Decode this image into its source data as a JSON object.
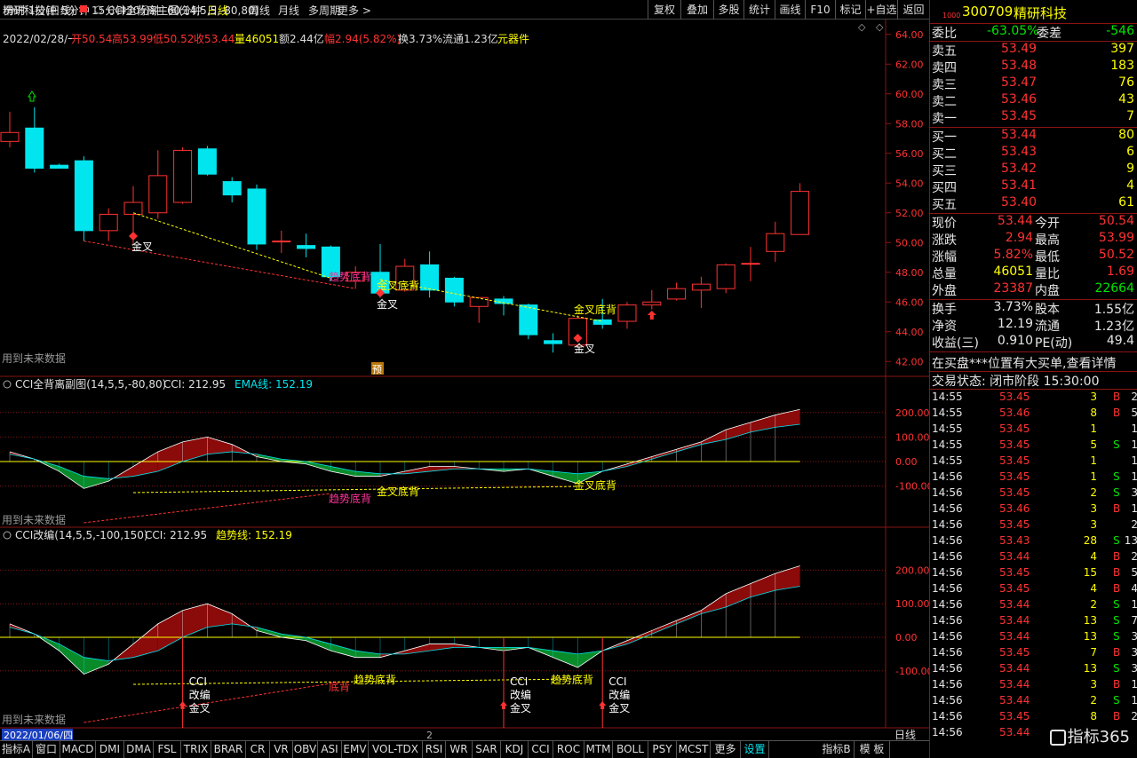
{
  "toolbar": {
    "timeframes": [
      "分时",
      "1分钟",
      "5分钟",
      "15分钟",
      "30分钟",
      "60分钟",
      "日线",
      "周线",
      "月线",
      "多周期",
      "更多 >"
    ],
    "right_buttons": [
      "复权",
      "叠加",
      "多股",
      "统计",
      "画线",
      "F10",
      "标记",
      "+自选",
      "返回"
    ]
  },
  "main": {
    "title": "精研科技(日线)",
    "indicator": "CCI全背离主图(14,5,5,-80,80)",
    "ohlc_line": {
      "date": "2022/02/28/一",
      "open": "开50.54",
      "high": "高53.99",
      "low": "低50.52",
      "close": "收53.44",
      "volume": "量46051",
      "amount": "额2.44亿",
      "change": "幅2.94(5.82%)",
      "turnover": "换3.73%",
      "float": "流通1.23亿",
      "sector": "元器件"
    },
    "price_ticks": [
      "64.00",
      "62.00",
      "60.00",
      "58.00",
      "56.00",
      "54.00",
      "52.00",
      "50.00",
      "48.00",
      "46.00",
      "44.00",
      "42.00"
    ],
    "future_note": "用到未来数据",
    "pred_badge": "预",
    "labels": [
      "金叉",
      "趋势底背",
      "金叉底背",
      "金叉",
      "金叉底背",
      "金叉"
    ]
  },
  "sub1": {
    "title": "CCI全背离副图(14,5,5,-80,80)",
    "cci_label": "CCI: 212.95",
    "ema_label": "EMA线: 152.19",
    "ticks": [
      "200.00",
      "100.00",
      "0.00",
      "-100.00"
    ],
    "labels": [
      "趋势底背",
      "金叉底背",
      "金叉底背"
    ],
    "future_note": "用到未来数据"
  },
  "sub2": {
    "title": "CCI改编(14,5,5,-100,150)",
    "cci_label": "CCI: 212.95",
    "trend_label": "趋势线: 152.19",
    "ticks": [
      "200.00",
      "100.00",
      "0.00",
      "-100.00"
    ],
    "signal_lines": [
      "CCI",
      "改编",
      "金叉"
    ],
    "labels": [
      "底背",
      "趋势底背",
      "趋势底背"
    ],
    "future_note": "用到未来数据"
  },
  "date_footer": "2022/01/06/四",
  "page_marker": "2",
  "period_label": "日线",
  "bottom_tabs": [
    "指标A",
    "窗口",
    "MACD",
    "DMI",
    "DMA",
    "FSL",
    "TRIX",
    "BRAR",
    "CR",
    "VR",
    "OBV",
    "ASI",
    "EMV",
    "VOL-TDX",
    "RSI",
    "WR",
    "SAR",
    "KDJ",
    "CCI",
    "ROC",
    "MTM",
    "BOLL",
    "PSY",
    "MCST",
    "更多",
    "设置"
  ],
  "bottom_right": [
    "指标B",
    "模 板"
  ],
  "quote": {
    "code": "300709",
    "name": "精研科技",
    "mini": "1000",
    "weibi_label": "委比",
    "weibi": "-63.05%",
    "weicha_label": "委差",
    "weicha": "-546",
    "asks": [
      {
        "label": "卖五",
        "price": "53.49",
        "vol": "397"
      },
      {
        "label": "卖四",
        "price": "53.48",
        "vol": "183"
      },
      {
        "label": "卖三",
        "price": "53.47",
        "vol": "76"
      },
      {
        "label": "卖二",
        "price": "53.46",
        "vol": "43"
      },
      {
        "label": "卖一",
        "price": "53.45",
        "vol": "7"
      }
    ],
    "bids": [
      {
        "label": "买一",
        "price": "53.44",
        "vol": "80"
      },
      {
        "label": "买二",
        "price": "53.43",
        "vol": "6"
      },
      {
        "label": "买三",
        "price": "53.42",
        "vol": "9"
      },
      {
        "label": "买四",
        "price": "53.41",
        "vol": "4"
      },
      {
        "label": "买五",
        "price": "53.40",
        "vol": "61"
      }
    ],
    "stats": [
      {
        "l1": "现价",
        "v1": "53.44",
        "c1": "red",
        "l2": "今开",
        "v2": "50.54",
        "c2": "red"
      },
      {
        "l1": "涨跌",
        "v1": "2.94",
        "c1": "red",
        "l2": "最高",
        "v2": "53.99",
        "c2": "red"
      },
      {
        "l1": "涨幅",
        "v1": "5.82%",
        "c1": "red",
        "l2": "最低",
        "v2": "50.52",
        "c2": "red"
      },
      {
        "l1": "总量",
        "v1": "46051",
        "c1": "yellow",
        "l2": "量比",
        "v2": "1.69",
        "c2": "red"
      },
      {
        "l1": "外盘",
        "v1": "23387",
        "c1": "red",
        "l2": "内盘",
        "v2": "22664",
        "c2": "green"
      }
    ],
    "stats2": [
      {
        "l1": "换手",
        "v1": "3.73%",
        "l2": "股本",
        "v2": "1.55亿"
      },
      {
        "l1": "净资",
        "v1": "12.19",
        "l2": "流通",
        "v2": "1.23亿"
      },
      {
        "l1": "收益(三)",
        "v1": "0.910",
        "l2": "PE(动)",
        "v2": "49.4"
      }
    ],
    "notice": "在买盘***位置有大买单,查看详情",
    "status": "交易状态: 闭市阶段 15:30:00",
    "ticks": [
      {
        "t": "14:55",
        "p": "53.45",
        "v": "3",
        "d": "B",
        "n": "2"
      },
      {
        "t": "14:55",
        "p": "53.46",
        "v": "8",
        "d": "B",
        "n": "5"
      },
      {
        "t": "14:55",
        "p": "53.45",
        "v": "1",
        "d": "",
        "n": "1"
      },
      {
        "t": "14:55",
        "p": "53.45",
        "v": "5",
        "d": "S",
        "n": "1"
      },
      {
        "t": "14:55",
        "p": "53.45",
        "v": "1",
        "d": "",
        "n": "1"
      },
      {
        "t": "14:56",
        "p": "53.45",
        "v": "1",
        "d": "S",
        "n": "1"
      },
      {
        "t": "14:56",
        "p": "53.45",
        "v": "2",
        "d": "S",
        "n": "3"
      },
      {
        "t": "14:56",
        "p": "53.46",
        "v": "3",
        "d": "B",
        "n": "1"
      },
      {
        "t": "14:56",
        "p": "53.45",
        "v": "3",
        "d": "",
        "n": "2"
      },
      {
        "t": "14:56",
        "p": "53.43",
        "v": "28",
        "d": "S",
        "n": "13"
      },
      {
        "t": "14:56",
        "p": "53.44",
        "v": "4",
        "d": "B",
        "n": "2"
      },
      {
        "t": "14:56",
        "p": "53.45",
        "v": "15",
        "d": "B",
        "n": "5"
      },
      {
        "t": "14:56",
        "p": "53.45",
        "v": "4",
        "d": "B",
        "n": "4"
      },
      {
        "t": "14:56",
        "p": "53.44",
        "v": "2",
        "d": "S",
        "n": "1"
      },
      {
        "t": "14:56",
        "p": "53.44",
        "v": "13",
        "d": "S",
        "n": "7"
      },
      {
        "t": "14:56",
        "p": "53.44",
        "v": "13",
        "d": "S",
        "n": "3"
      },
      {
        "t": "14:56",
        "p": "53.45",
        "v": "7",
        "d": "B",
        "n": "3"
      },
      {
        "t": "14:56",
        "p": "53.44",
        "v": "13",
        "d": "S",
        "n": "3"
      },
      {
        "t": "14:56",
        "p": "53.44",
        "v": "3",
        "d": "B",
        "n": "1"
      },
      {
        "t": "14:56",
        "p": "53.44",
        "v": "2",
        "d": "S",
        "n": "1"
      },
      {
        "t": "14:56",
        "p": "53.45",
        "v": "8",
        "d": "B",
        "n": "2"
      },
      {
        "t": "14:56",
        "p": "53.44",
        "v": "",
        "d": "",
        "n": ""
      }
    ],
    "watermark": "指标365"
  },
  "colors": {
    "up": "#ff3232",
    "down": "#00e5ee",
    "grid": "#8a1414",
    "yellow": "#ffff00"
  },
  "chart_data": {
    "type": "candlestick",
    "price_range": [
      41,
      65
    ],
    "candles": [
      {
        "o": 56.8,
        "c": 57.4,
        "h": 58.8,
        "l": 56.4
      },
      {
        "o": 57.7,
        "c": 55.0,
        "h": 59.1,
        "l": 54.7
      },
      {
        "o": 55.2,
        "c": 55.0,
        "h": 55.3,
        "l": 55.0
      },
      {
        "o": 55.5,
        "c": 50.8,
        "h": 55.8,
        "l": 50.1
      },
      {
        "o": 50.8,
        "c": 51.9,
        "h": 52.3,
        "l": 50.1
      },
      {
        "o": 51.9,
        "c": 52.7,
        "h": 53.8,
        "l": 49.9
      },
      {
        "o": 52.0,
        "c": 54.5,
        "h": 56.2,
        "l": 51.6
      },
      {
        "o": 52.7,
        "c": 56.2,
        "h": 56.4,
        "l": 52.6
      },
      {
        "o": 56.3,
        "c": 54.6,
        "h": 56.5,
        "l": 54.5
      },
      {
        "o": 54.1,
        "c": 53.2,
        "h": 54.4,
        "l": 52.7
      },
      {
        "o": 53.6,
        "c": 49.9,
        "h": 53.9,
        "l": 49.5
      },
      {
        "o": 50.1,
        "c": 50.1,
        "h": 50.8,
        "l": 49.3
      },
      {
        "o": 49.8,
        "c": 49.6,
        "h": 50.6,
        "l": 49.0
      },
      {
        "o": 49.7,
        "c": 47.7,
        "h": 49.8,
        "l": 47.4
      },
      {
        "o": 47.4,
        "c": 48.0,
        "h": 48.4,
        "l": 46.9
      },
      {
        "o": 48.0,
        "c": 46.6,
        "h": 49.9,
        "l": 46.3
      },
      {
        "o": 46.8,
        "c": 48.4,
        "h": 48.9,
        "l": 46.7
      },
      {
        "o": 48.5,
        "c": 46.8,
        "h": 49.4,
        "l": 46.3
      },
      {
        "o": 47.6,
        "c": 46.0,
        "h": 47.7,
        "l": 45.7
      },
      {
        "o": 45.7,
        "c": 46.3,
        "h": 46.3,
        "l": 44.6
      },
      {
        "o": 46.2,
        "c": 45.9,
        "h": 46.4,
        "l": 45.1
      },
      {
        "o": 45.8,
        "c": 43.8,
        "h": 45.9,
        "l": 43.5
      },
      {
        "o": 43.4,
        "c": 43.2,
        "h": 43.9,
        "l": 42.6
      },
      {
        "o": 43.1,
        "c": 44.9,
        "h": 45.1,
        "l": 42.9
      },
      {
        "o": 44.8,
        "c": 44.5,
        "h": 46.2,
        "l": 44.2
      },
      {
        "o": 44.7,
        "c": 45.8,
        "h": 46.0,
        "l": 44.2
      },
      {
        "o": 45.8,
        "c": 46.0,
        "h": 46.8,
        "l": 45.5
      },
      {
        "o": 46.2,
        "c": 46.9,
        "h": 47.3,
        "l": 46.1
      },
      {
        "o": 46.8,
        "c": 47.2,
        "h": 47.7,
        "l": 45.6
      },
      {
        "o": 46.9,
        "c": 48.5,
        "h": 48.6,
        "l": 46.6
      },
      {
        "o": 48.6,
        "c": 48.6,
        "h": 49.7,
        "l": 47.4
      },
      {
        "o": 49.4,
        "c": 50.6,
        "h": 51.4,
        "l": 48.7
      },
      {
        "o": 50.54,
        "c": 53.44,
        "h": 53.99,
        "l": 50.52
      }
    ],
    "cci_sub1": {
      "cci": [
        40,
        10,
        -40,
        -110,
        -80,
        -20,
        40,
        80,
        100,
        70,
        20,
        0,
        -10,
        -40,
        -60,
        -60,
        -40,
        -20,
        -20,
        -30,
        -40,
        -30,
        -60,
        -90,
        -40,
        -10,
        20,
        50,
        80,
        130,
        160,
        190,
        212.95
      ],
      "ema": [
        30,
        10,
        -20,
        -60,
        -70,
        -60,
        -40,
        0,
        30,
        40,
        30,
        10,
        0,
        -20,
        -40,
        -50,
        -50,
        -40,
        -30,
        -30,
        -30,
        -30,
        -40,
        -50,
        -40,
        -20,
        10,
        40,
        70,
        90,
        120,
        140,
        152.19
      ]
    },
    "cci_sub2": {
      "cci": [
        40,
        10,
        -40,
        -110,
        -80,
        -20,
        40,
        80,
        100,
        70,
        20,
        0,
        -10,
        -40,
        -60,
        -60,
        -40,
        -20,
        -20,
        -30,
        -40,
        -30,
        -60,
        -90,
        -40,
        -10,
        20,
        50,
        80,
        130,
        160,
        190,
        212.95
      ],
      "trend": [
        30,
        10,
        -20,
        -60,
        -70,
        -60,
        -40,
        0,
        30,
        40,
        30,
        10,
        0,
        -20,
        -40,
        -50,
        -50,
        -40,
        -30,
        -30,
        -30,
        -30,
        -40,
        -50,
        -40,
        -20,
        10,
        40,
        70,
        90,
        120,
        140,
        152.19
      ]
    }
  }
}
